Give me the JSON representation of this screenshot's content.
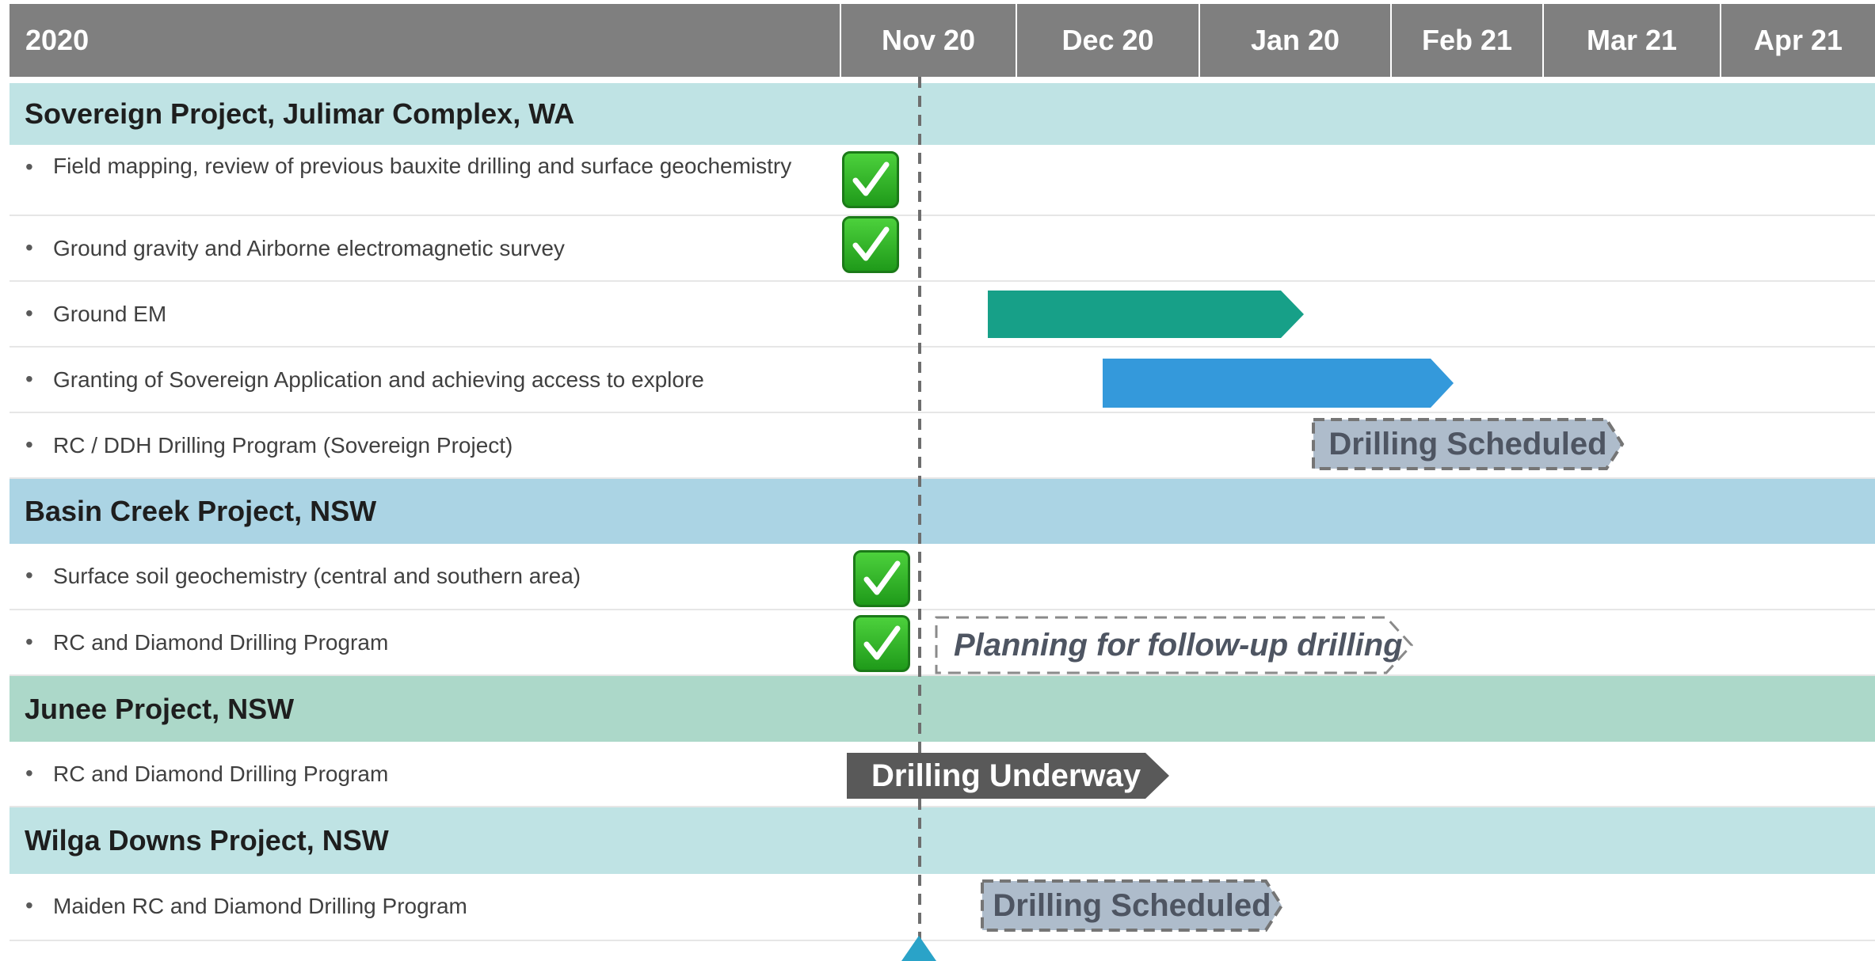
{
  "header": {
    "year": "2020",
    "months": [
      "Nov 20",
      "Dec 20",
      "Jan 20",
      "Feb 21",
      "Mar 21",
      "Apr 21"
    ]
  },
  "sections": [
    {
      "title": "Sovereign Project, Julimar Complex, WA",
      "color": "#bfe3e4",
      "tasks": [
        {
          "label": "Field mapping, review of previous bauxite drilling and surface geochemistry",
          "status": "complete"
        },
        {
          "label": "Ground gravity and Airborne electromagnetic survey",
          "status": "complete"
        },
        {
          "label": "Ground EM",
          "bar_color": "#17a088"
        },
        {
          "label": "Granting of Sovereign Application and achieving access to explore",
          "bar_color": "#3499db"
        },
        {
          "label": "RC / DDH Drilling Program (Sovereign Project)",
          "bar_text": "Drilling Scheduled"
        }
      ]
    },
    {
      "title": "Basin Creek Project, NSW",
      "color": "#abd4e4",
      "tasks": [
        {
          "label": "Surface soil geochemistry (central and southern area)",
          "status": "complete"
        },
        {
          "label": "RC and Diamond Drilling Program",
          "status": "complete",
          "bar_text": "Planning for follow-up drilling"
        }
      ]
    },
    {
      "title": "Junee Project, NSW",
      "color": "#acd8c9",
      "tasks": [
        {
          "label": "RC and Diamond Drilling Program",
          "bar_text": "Drilling Underway"
        }
      ]
    },
    {
      "title": "Wilga Downs Project, NSW",
      "color": "#bfe3e4",
      "tasks": [
        {
          "label": "Maiden RC and Diamond Drilling Program",
          "bar_text": "Drilling Scheduled"
        }
      ]
    }
  ],
  "colors": {
    "header_bg": "#7f7f7f",
    "scheduled_fill": "#aebccb",
    "underway_fill": "#595959",
    "today_marker": "#2aa3c8"
  }
}
